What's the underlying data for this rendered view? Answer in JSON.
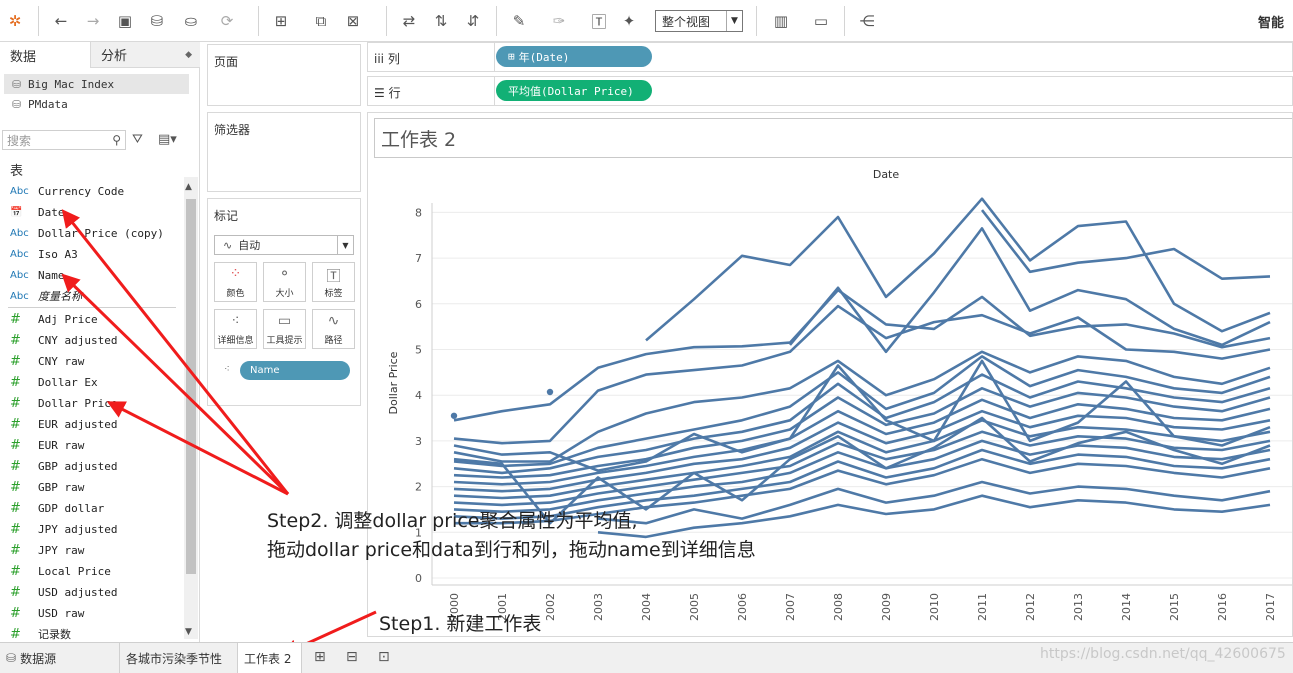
{
  "toolbar": {
    "view_mode": "整个视图",
    "smart_label": "智能"
  },
  "data_pane": {
    "tabs": [
      "数据",
      "分析"
    ],
    "datasources": [
      {
        "name": "Big Mac Index",
        "selected": true
      },
      {
        "name": "PMdata",
        "selected": false
      }
    ],
    "search_placeholder": "搜索",
    "tables_title": "表",
    "dimensions": [
      {
        "type": "Abc",
        "name": "Currency Code"
      },
      {
        "type": "date",
        "name": "Date"
      },
      {
        "type": "Abc",
        "name": "Dollar Price (copy)"
      },
      {
        "type": "Abc",
        "name": "Iso A3"
      },
      {
        "type": "Abc",
        "name": "Name"
      },
      {
        "type": "Abc",
        "name": "度量名称",
        "italic": true
      }
    ],
    "measures": [
      "Adj Price",
      "CNY adjusted",
      "CNY raw",
      "Dollar Ex",
      "Dollar Price",
      "EUR adjusted",
      "EUR raw",
      "GBP adjusted",
      "GBP raw",
      "GDP dollar",
      "JPY adjusted",
      "JPY raw",
      "Local Price",
      "USD adjusted",
      "USD raw",
      "记录数"
    ]
  },
  "cards": {
    "pages_title": "页面",
    "filters_title": "筛选器",
    "marks_title": "标记",
    "mark_type": "自动",
    "mark_buttons": [
      {
        "icon": "color-icon",
        "label": "颜色"
      },
      {
        "icon": "size-icon",
        "label": "大小"
      },
      {
        "icon": "text-icon",
        "label": "标签"
      },
      {
        "icon": "detail-icon",
        "label": "详细信息"
      },
      {
        "icon": "tooltip-icon",
        "label": "工具提示"
      },
      {
        "icon": "path-icon",
        "label": "路径"
      }
    ],
    "detail_pill": "Name"
  },
  "shelves": {
    "columns_label": "列",
    "columns_pill": "年(Date)",
    "rows_label": "行",
    "rows_pill": "平均值(Dollar Price)"
  },
  "view": {
    "sheet_title": "工作表 2"
  },
  "chart_data": {
    "type": "line",
    "title": "Date",
    "xlabel": "Date",
    "ylabel": "Dollar Price",
    "categories": [
      "2000",
      "2001",
      "2002",
      "2003",
      "2004",
      "2005",
      "2006",
      "2007",
      "2008",
      "2009",
      "2010",
      "2011",
      "2012",
      "2013",
      "2014",
      "2015",
      "2016",
      "2017"
    ],
    "ylim": [
      0,
      8.5
    ],
    "y_ticks": [
      0,
      1,
      2,
      3,
      4,
      5,
      6,
      7,
      8
    ],
    "grid": true,
    "color": "#4e79a7",
    "series": [
      {
        "values": [
          null,
          null,
          null,
          null,
          5.2,
          6.1,
          7.05,
          6.85,
          7.9,
          6.15,
          7.1,
          8.3,
          6.95,
          7.7,
          7.8,
          6.0,
          5.4,
          5.8
        ]
      },
      {
        "values": [
          null,
          null,
          null,
          null,
          null,
          null,
          null,
          null,
          null,
          null,
          null,
          8.05,
          6.7,
          6.9,
          7.0,
          7.2,
          6.55,
          6.6
        ]
      },
      {
        "values": [
          null,
          null,
          null,
          null,
          null,
          null,
          null,
          5.1,
          6.35,
          4.95,
          6.25,
          7.65,
          5.85,
          6.3,
          6.1,
          5.45,
          5.1,
          5.6
        ]
      },
      {
        "values": [
          3.45,
          3.65,
          3.8,
          4.6,
          4.9,
          5.05,
          5.07,
          5.15,
          6.3,
          5.55,
          5.45,
          6.15,
          5.3,
          5.5,
          5.55,
          5.35,
          5.05,
          5.25
        ]
      },
      {
        "values": [
          3.05,
          2.95,
          3.0,
          4.1,
          4.45,
          4.55,
          4.65,
          4.95,
          5.95,
          5.25,
          5.6,
          5.75,
          5.35,
          5.7,
          5.0,
          4.95,
          4.8,
          5.0
        ]
      },
      {
        "values": [
          2.75,
          2.55,
          2.55,
          3.2,
          3.6,
          3.85,
          3.95,
          4.15,
          4.75,
          4.0,
          4.35,
          4.95,
          4.5,
          4.85,
          4.75,
          4.4,
          4.25,
          4.6
        ]
      },
      {
        "values": [
          2.55,
          2.45,
          2.5,
          2.85,
          3.05,
          3.25,
          3.45,
          3.75,
          4.5,
          3.7,
          4.05,
          4.85,
          4.2,
          4.55,
          4.4,
          4.15,
          4.05,
          4.4
        ]
      },
      {
        "values": [
          2.4,
          2.3,
          2.4,
          2.65,
          2.8,
          3.05,
          3.2,
          3.45,
          4.25,
          3.5,
          3.85,
          4.45,
          3.95,
          4.3,
          4.15,
          3.95,
          3.85,
          4.15
        ]
      },
      {
        "values": [
          2.25,
          2.2,
          2.25,
          2.45,
          2.6,
          2.85,
          3.0,
          3.25,
          3.95,
          3.35,
          3.6,
          4.15,
          3.75,
          4.05,
          3.95,
          3.75,
          3.65,
          3.95
        ]
      },
      {
        "values": [
          2.1,
          2.05,
          2.1,
          2.3,
          2.45,
          2.65,
          2.8,
          3.05,
          3.65,
          3.15,
          3.4,
          3.9,
          3.5,
          3.8,
          3.7,
          3.5,
          3.45,
          3.7
        ]
      },
      {
        "values": [
          1.95,
          1.9,
          1.95,
          2.15,
          2.3,
          2.5,
          2.6,
          2.85,
          3.4,
          2.95,
          3.2,
          3.65,
          3.3,
          3.55,
          3.5,
          3.3,
          3.25,
          3.45
        ]
      },
      {
        "values": [
          1.8,
          1.75,
          1.8,
          2.0,
          2.15,
          2.3,
          2.45,
          2.65,
          3.2,
          2.75,
          3.0,
          3.45,
          3.1,
          3.3,
          3.25,
          3.1,
          3.0,
          3.2
        ]
      },
      {
        "values": [
          1.65,
          1.6,
          1.65,
          1.85,
          2.0,
          2.15,
          2.3,
          2.45,
          2.95,
          2.6,
          2.8,
          3.2,
          2.9,
          3.1,
          3.05,
          2.85,
          2.8,
          3.0
        ]
      },
      {
        "values": [
          1.5,
          1.45,
          1.5,
          1.7,
          1.85,
          2.0,
          2.1,
          2.3,
          2.75,
          2.4,
          2.6,
          3.0,
          2.7,
          2.9,
          2.85,
          2.65,
          2.6,
          2.8
        ]
      },
      {
        "values": [
          1.35,
          1.3,
          1.35,
          1.55,
          1.7,
          1.8,
          1.95,
          2.1,
          2.55,
          2.2,
          2.4,
          2.8,
          2.5,
          2.7,
          2.65,
          2.45,
          2.4,
          2.6
        ]
      },
      {
        "values": [
          1.2,
          1.2,
          1.25,
          1.4,
          1.55,
          1.65,
          1.8,
          1.95,
          2.35,
          2.05,
          2.25,
          2.6,
          2.3,
          2.5,
          2.45,
          2.3,
          2.2,
          2.4
        ]
      },
      {
        "values": [
          2.6,
          2.5,
          1.2,
          2.2,
          1.5,
          2.3,
          1.7,
          2.6,
          3.1,
          2.4,
          2.85,
          3.5,
          2.55,
          2.95,
          3.2,
          2.8,
          2.5,
          2.9
        ]
      },
      {
        "values": [
          2.9,
          2.7,
          2.75,
          2.35,
          2.55,
          3.15,
          2.75,
          3.05,
          4.65,
          3.45,
          3.0,
          4.75,
          3.0,
          3.4,
          4.3,
          3.1,
          2.9,
          3.3
        ]
      },
      {
        "values": [
          null,
          null,
          null,
          1.3,
          1.2,
          1.5,
          1.3,
          1.6,
          1.95,
          1.65,
          1.8,
          2.1,
          1.85,
          2.0,
          1.95,
          1.8,
          1.7,
          1.9
        ]
      },
      {
        "values": [
          null,
          null,
          null,
          1.0,
          0.9,
          1.1,
          1.2,
          1.35,
          1.6,
          1.4,
          1.5,
          1.8,
          1.55,
          1.7,
          1.65,
          1.5,
          1.45,
          1.6
        ]
      }
    ],
    "points": [
      {
        "x": "2000",
        "y": 3.55
      },
      {
        "x": "2002",
        "y": 4.07
      }
    ]
  },
  "annotations": {
    "step2_line1": "Step2. 调整dollar price聚合属性为平均值,",
    "step2_line2": "拖动dollar price和data到行和列，拖动name到详细信息",
    "step1": "Step1. 新建工作表"
  },
  "bottom_tabs": {
    "datasource": "数据源",
    "sheet1": "各城市污染季节性",
    "sheet2": "工作表 2"
  },
  "watermark": "https://blog.csdn.net/qq_42600675"
}
